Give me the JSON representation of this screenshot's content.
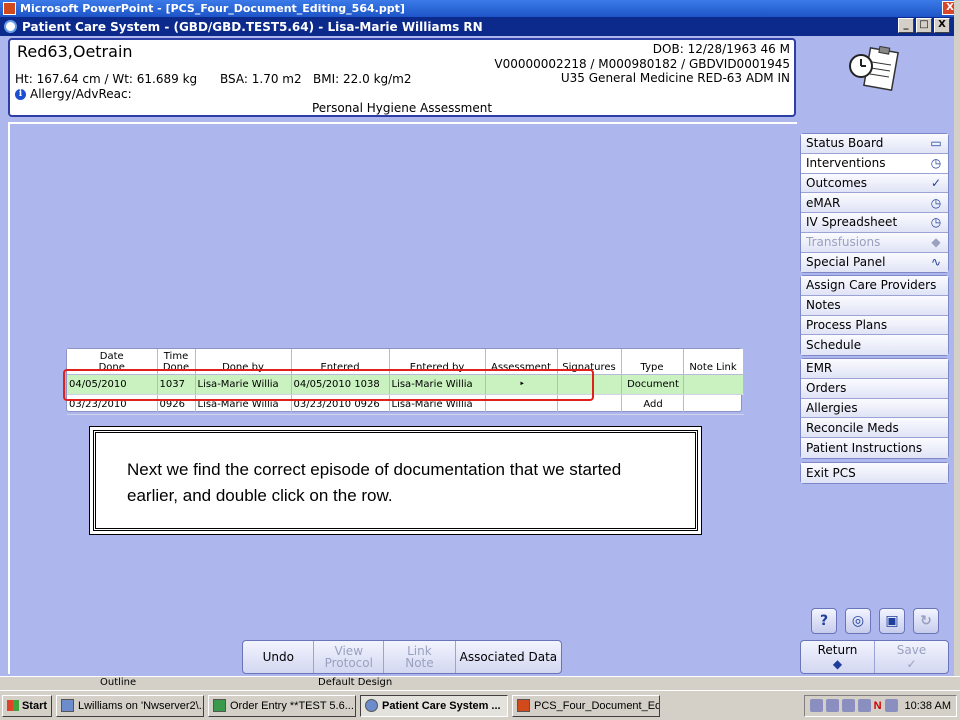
{
  "ppt_window": {
    "title": "Microsoft PowerPoint - [PCS_Four_Document_Editing_564.ppt]",
    "close_symbol": "X"
  },
  "pcs_window": {
    "title": "Patient Care System - (GBD/GBD.TEST5.64) - Lisa-Marie Williams RN",
    "controls": [
      "_",
      "□",
      "X"
    ]
  },
  "patient": {
    "name": "Red63,Oetrain",
    "measures": "Ht: 167.64 cm / Wt: 61.689 kg      BSA: 1.70 m2   BMI: 22.0 kg/m2",
    "allergy_label": "Allergy/AdvReac:",
    "dob": "DOB: 12/28/1963 46 M",
    "ids": "V00000002218 / M000980182 / GBDVID0001945",
    "location": "U35 General Medicine  RED-63  ADM IN"
  },
  "assessment_title": "Personal Hygiene Assessment",
  "doc_table": {
    "headers": [
      [
        "Date",
        "Done"
      ],
      [
        "Time",
        "Done"
      ],
      [
        "Done by"
      ],
      [
        "Entered"
      ],
      [
        "Entered by"
      ],
      [
        "Assessment"
      ],
      [
        "Signatures"
      ],
      [
        "Type"
      ],
      [
        "Note Link"
      ]
    ],
    "rows": [
      {
        "date": "04/05/2010",
        "time": "1037",
        "done_by": "Lisa-Marie Willia",
        "entered": "04/05/2010 1038",
        "entered_by": "Lisa-Marie Willia",
        "assessment": "‣",
        "signatures": "",
        "type": "Document",
        "note_link": ""
      },
      {
        "date": "03/23/2010",
        "time": "0926",
        "done_by": "Lisa-Marie Willia",
        "entered": "03/23/2010 0926",
        "entered_by": "Lisa-Marie Willia",
        "assessment": "",
        "signatures": "",
        "type": "Add",
        "note_link": ""
      }
    ]
  },
  "callout": {
    "text": "Next we find the correct episode of documentation that we started earlier, and double click on the row."
  },
  "nav": {
    "group1": [
      {
        "label": "Status Board",
        "icon": "board-icon",
        "glyph": "▭"
      },
      {
        "label": "Interventions",
        "icon": "interventions-icon",
        "glyph": "◷"
      },
      {
        "label": "Outcomes",
        "icon": "outcomes-icon",
        "glyph": "✓"
      },
      {
        "label": "eMAR",
        "icon": "emar-icon",
        "glyph": "◷"
      },
      {
        "label": "IV Spreadsheet",
        "icon": "iv-icon",
        "glyph": "◷"
      },
      {
        "label": "Transfusions",
        "icon": "transfusion-icon",
        "glyph": "◆"
      },
      {
        "label": "Special Panel",
        "icon": "pulse-icon",
        "glyph": "∿"
      }
    ],
    "group2": [
      "Assign Care Providers",
      "Notes",
      "Process Plans",
      "Schedule"
    ],
    "group3": [
      "EMR",
      "Orders",
      "Allergies",
      "Reconcile Meds",
      "Patient Instructions"
    ],
    "group4": [
      "Exit PCS"
    ]
  },
  "action_icons": [
    {
      "name": "help-icon",
      "glyph": "?"
    },
    {
      "name": "lookup-icon",
      "glyph": "◎"
    },
    {
      "name": "lock-icon",
      "glyph": "▣"
    },
    {
      "name": "refresh-icon",
      "glyph": "↻"
    }
  ],
  "return_save": {
    "return_label": "Return",
    "return_glyph": "◆",
    "save_label": "Save",
    "save_glyph": "✓"
  },
  "toolbar": {
    "undo": "Undo",
    "view_protocol": "View Protocol",
    "link_note": "Link Note",
    "associated_data": "Associated Data"
  },
  "ppt_status": {
    "outline": "Outline",
    "design": "Default Design"
  },
  "taskbar": {
    "start": "Start",
    "tasks": [
      "Lwilliams on 'Nwserver2\\...",
      "Order Entry **TEST 5.6...",
      "Patient Care System ...",
      "PCS_Four_Document_Ed..."
    ],
    "active_index": 2,
    "clock": "10:38 AM",
    "tray_letter": "N"
  }
}
